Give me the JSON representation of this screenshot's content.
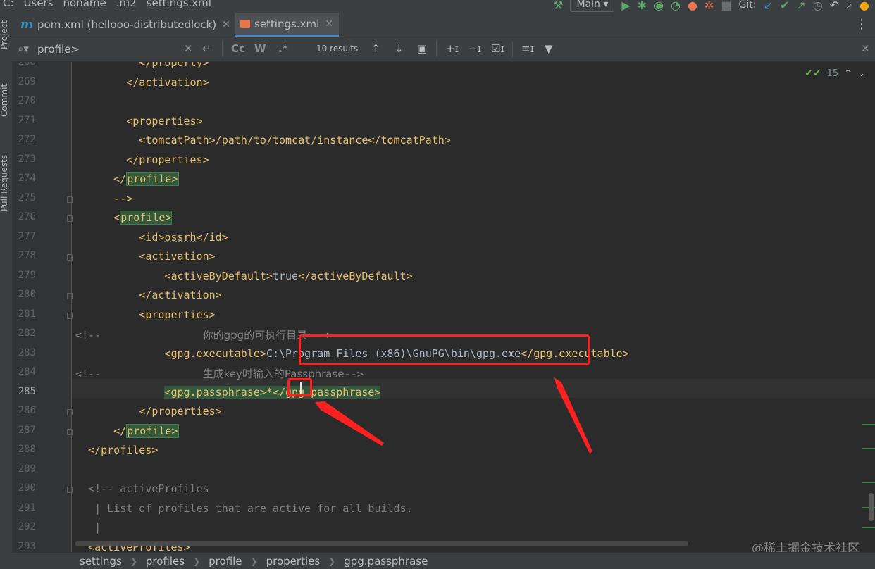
{
  "top_breadcrumb": [
    "C:",
    "Users",
    "noname",
    ".m2",
    "settings.xml"
  ],
  "toolbar": {
    "run_config": "Main",
    "git_label": "Git:"
  },
  "left_tabs": [
    "Project",
    "Commit",
    "Pull Requests"
  ],
  "tabs": [
    {
      "label": "pom.xml (hellooo-distributedlock)",
      "icon": "maven-icon",
      "active": false
    },
    {
      "label": "settings.xml",
      "icon": "xml-file-icon",
      "active": true
    }
  ],
  "search": {
    "query": "profile>",
    "results": "10 results",
    "match_case": "Cc",
    "words": "W",
    "regex": ".*"
  },
  "inspection": {
    "count": "15"
  },
  "lines": [
    {
      "n": "268",
      "segs": [
        {
          "t": "          </property>",
          "c": "tag"
        }
      ]
    },
    {
      "n": "269",
      "segs": [
        {
          "t": "        </activation>",
          "c": "tag"
        }
      ]
    },
    {
      "n": "270",
      "segs": []
    },
    {
      "n": "271",
      "segs": [
        {
          "t": "        <properties>",
          "c": "tag"
        }
      ]
    },
    {
      "n": "272",
      "segs": [
        {
          "t": "          <tomcatPath>/path/to/tomcat/instance</tomcatPath>",
          "c": "tag"
        }
      ]
    },
    {
      "n": "273",
      "segs": [
        {
          "t": "        </properties>",
          "c": "tag"
        }
      ]
    },
    {
      "n": "274",
      "segs": [
        {
          "t": "      </",
          "c": "tag"
        },
        {
          "t": "profile>",
          "c": "hl-match"
        }
      ]
    },
    {
      "n": "275",
      "segs": [
        {
          "t": "      -->",
          "c": "tag"
        }
      ]
    },
    {
      "n": "276",
      "segs": [
        {
          "t": "      <",
          "c": "tag"
        },
        {
          "t": "profile>",
          "c": "hl-match"
        }
      ]
    },
    {
      "n": "277",
      "segs": [
        {
          "t": "          <id>",
          "c": "tag"
        },
        {
          "t": "ossrh",
          "c": "wavy"
        },
        {
          "t": "</id>",
          "c": "tag"
        }
      ]
    },
    {
      "n": "278",
      "segs": [
        {
          "t": "          <activation>",
          "c": "tag"
        }
      ]
    },
    {
      "n": "279",
      "segs": [
        {
          "t": "              <activeByDefault>",
          "c": "tag"
        },
        {
          "t": "true",
          "c": "txt"
        },
        {
          "t": "</activeByDefault>",
          "c": "tag"
        }
      ]
    },
    {
      "n": "280",
      "segs": [
        {
          "t": "          </activation>",
          "c": "tag"
        }
      ]
    },
    {
      "n": "281",
      "segs": [
        {
          "t": "          <properties>",
          "c": "tag"
        }
      ]
    },
    {
      "n": "282",
      "segs": [
        {
          "t": "<!--                ",
          "c": "cmt"
        },
        {
          "t": "你的gpg的可执行目录",
          "c": "cn"
        },
        {
          "t": " -->",
          "c": "cmt"
        }
      ]
    },
    {
      "n": "283",
      "segs": [
        {
          "t": "              <gpg.executable>",
          "c": "tag"
        },
        {
          "t": "C:\\Program Files (x86)\\GnuPG\\bin\\gpg.exe",
          "c": "txt"
        },
        {
          "t": "</gpg.executable>",
          "c": "tag"
        }
      ]
    },
    {
      "n": "284",
      "segs": [
        {
          "t": "<!--                ",
          "c": "cmt"
        },
        {
          "t": "生成key时输入的Passphrase",
          "c": "cn"
        },
        {
          "t": "-->",
          "c": "cmt"
        }
      ]
    },
    {
      "n": "285",
      "segs": [
        {
          "t": "              ",
          "c": "tag"
        },
        {
          "t": "<gpg.passphrase>*</gpg.passphrase>",
          "c": "hl-soft"
        }
      ]
    },
    {
      "n": "286",
      "segs": [
        {
          "t": "          </properties>",
          "c": "tag"
        }
      ]
    },
    {
      "n": "287",
      "segs": [
        {
          "t": "      </",
          "c": "tag"
        },
        {
          "t": "profile>",
          "c": "hl-match"
        }
      ]
    },
    {
      "n": "288",
      "segs": [
        {
          "t": "  </profiles>",
          "c": "tag"
        }
      ]
    },
    {
      "n": "289",
      "segs": []
    },
    {
      "n": "290",
      "segs": [
        {
          "t": "  <!-- activeProfiles",
          "c": "cmt"
        }
      ]
    },
    {
      "n": "291",
      "segs": [
        {
          "t": "   | List of profiles that are active for all builds.",
          "c": "cmt"
        }
      ]
    },
    {
      "n": "292",
      "segs": [
        {
          "t": "   |",
          "c": "cmt"
        }
      ]
    },
    {
      "n": "293",
      "segs": [
        {
          "t": "  <activeProfiles>",
          "c": "tag"
        }
      ]
    }
  ],
  "current_line": "285",
  "watermark": "@稀土掘金技术社区",
  "status_breadcrumb": [
    "settings",
    "profiles",
    "profile",
    "properties",
    "gpg.passphrase"
  ],
  "colors": {
    "tag": "#e8bf6a",
    "text": "#a9b7c6",
    "comment": "#808080",
    "match_bg": "#32593d",
    "annotation": "#ff1f1f"
  }
}
